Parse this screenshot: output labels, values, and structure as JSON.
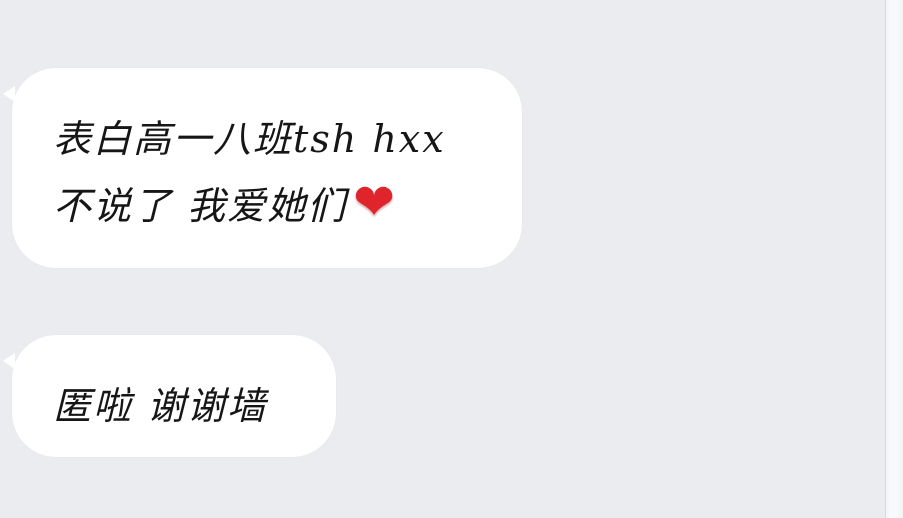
{
  "messages": [
    {
      "lines": [
        "表白高一八班tsh hxx",
        "不说了 我爱她们"
      ],
      "emoji": "❤"
    },
    {
      "lines": [
        "匿啦 谢谢墙"
      ]
    }
  ],
  "colors": {
    "background": "#ebecef",
    "bubble": "#ffffff",
    "text": "#161616",
    "heart": "#e0242c"
  },
  "icons": {
    "heart": "heart-emoji-icon"
  }
}
